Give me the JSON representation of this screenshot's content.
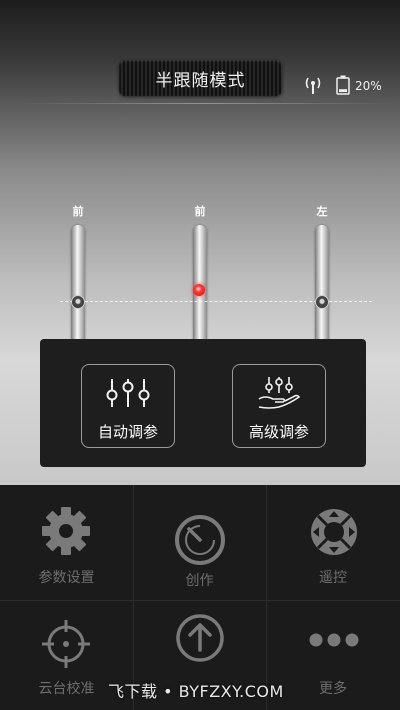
{
  "header": {
    "mode_label": "半跟随模式",
    "battery_percent": "20%",
    "battery_level": 0.2
  },
  "axes": [
    {
      "label": "前"
    },
    {
      "label": "前"
    },
    {
      "label": "左"
    }
  ],
  "tuning": {
    "auto_label": "自动调参",
    "advanced_label": "高级调参"
  },
  "menu": {
    "params_label": "参数设置",
    "create_label": "创作",
    "remote_label": "遥控",
    "calibrate_label": "云台校准",
    "more_label": "更多"
  },
  "watermark": "飞下载 • BYFZXY.COM",
  "colors": {
    "accent_red": "#ff3a3a",
    "menu_icon_gray": "#7a7a7a",
    "panel_bg": "#1e1e1e"
  }
}
